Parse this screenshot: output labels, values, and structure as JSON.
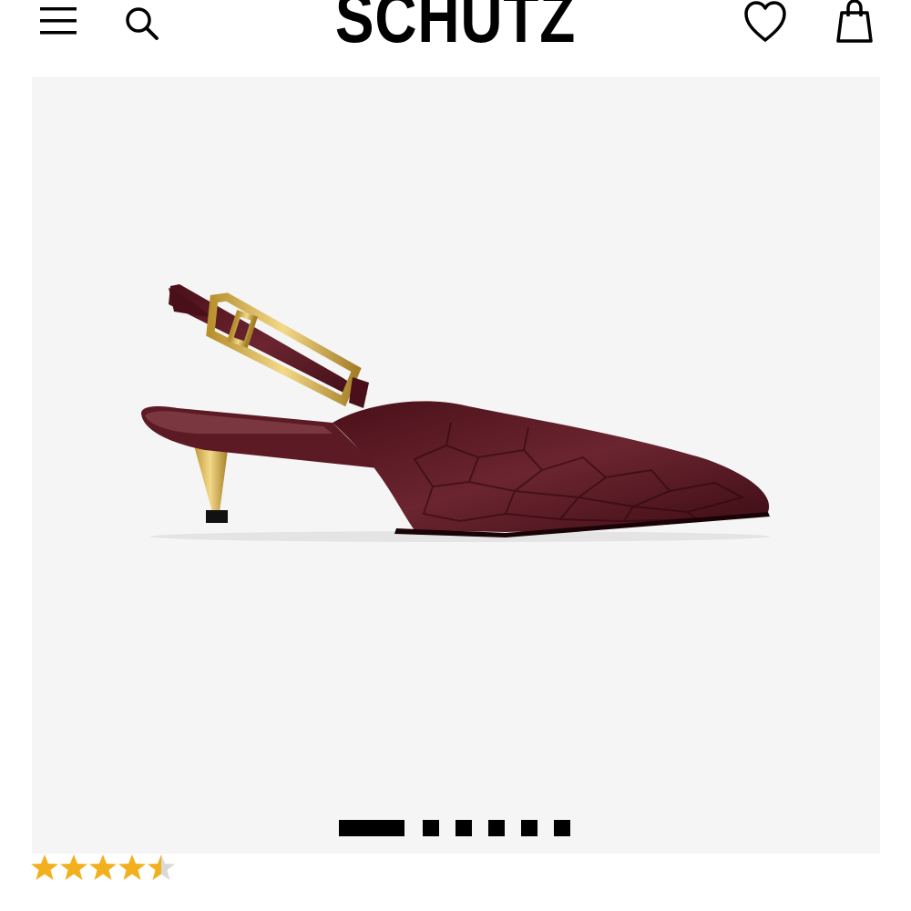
{
  "header": {
    "brand": "SCHUTZ",
    "icons": {
      "menu": "hamburger-menu-icon",
      "search": "search-icon",
      "wishlist": "heart-icon",
      "bag": "shopping-bag-icon"
    }
  },
  "gallery": {
    "image_count": 6,
    "active_index": 0,
    "background": "#f5f5f5",
    "product_colors": {
      "leather": "#5a1b24",
      "hardware": "#d9b25a"
    }
  },
  "rating": {
    "value": 4.5,
    "max": 5,
    "star_color": "#f2b01e",
    "empty_color": "#d9d9d9"
  }
}
